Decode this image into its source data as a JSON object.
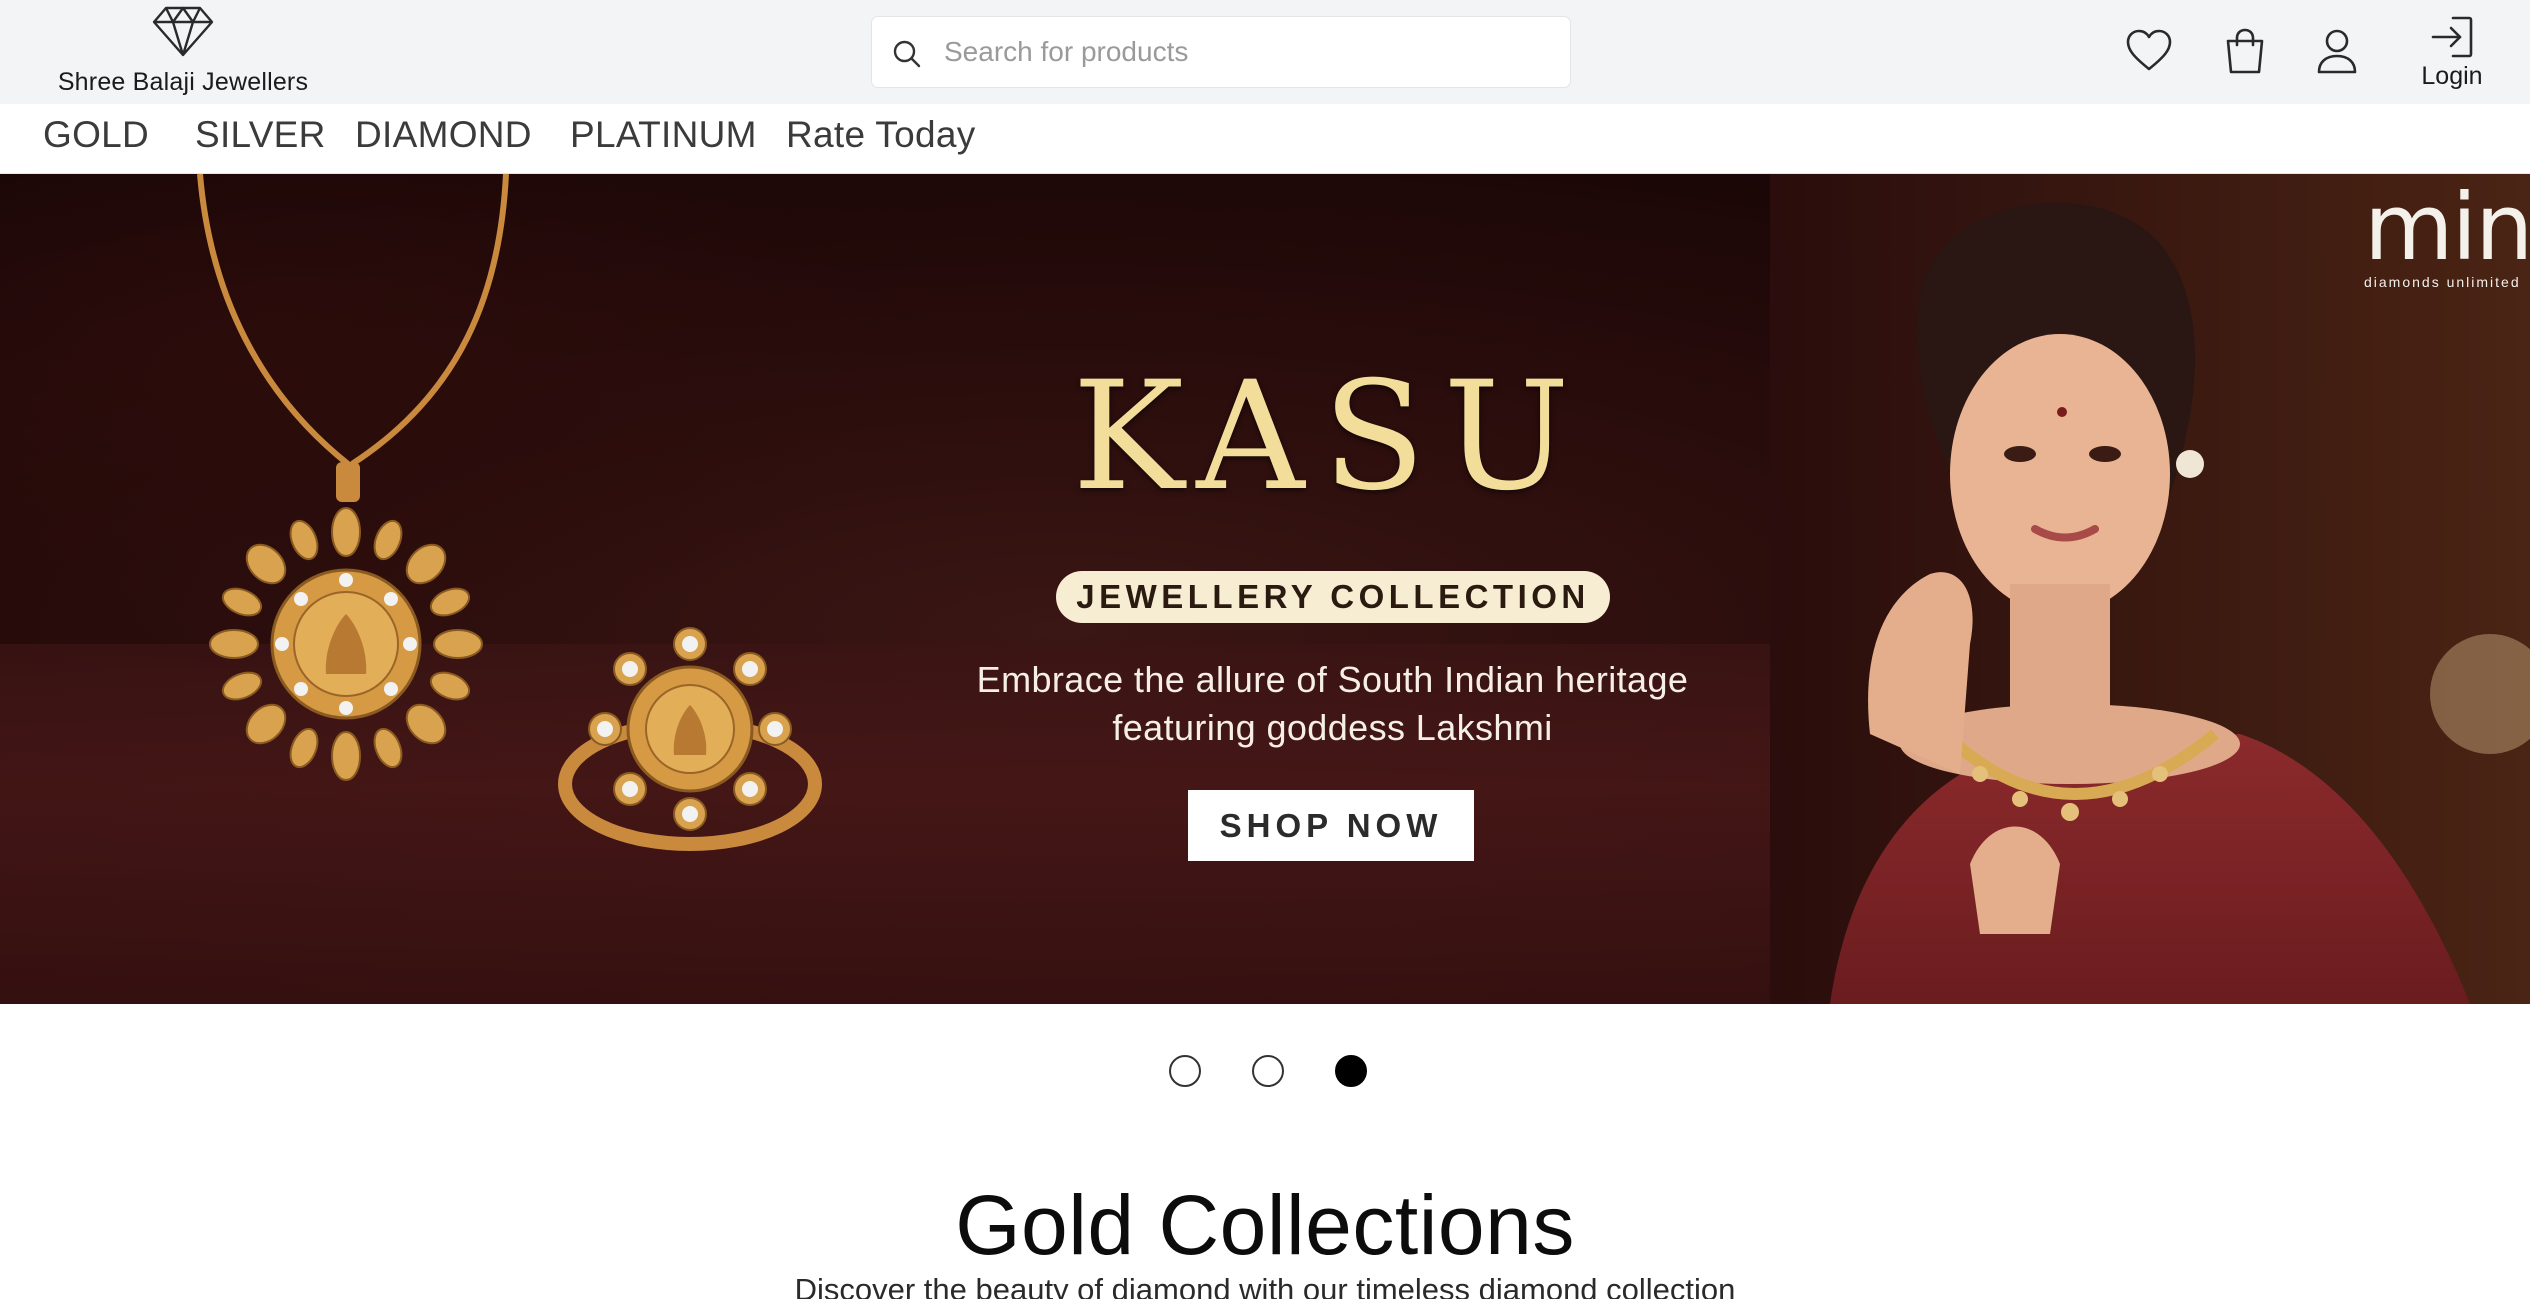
{
  "brand": {
    "name": "Shree Balaji Jewellers",
    "logo_icon": "diamond-icon"
  },
  "search": {
    "placeholder": "Search for products",
    "value": ""
  },
  "header_actions": {
    "wishlist_icon": "heart-icon",
    "cart_icon": "shopping-bag-icon",
    "account_icon": "user-icon",
    "login_icon": "login-arrow-icon",
    "login_label": "Login"
  },
  "nav": {
    "items": [
      {
        "label": "GOLD"
      },
      {
        "label": "SILVER"
      },
      {
        "label": "DIAMOND"
      },
      {
        "label": "PLATINUM"
      },
      {
        "label": "Rate Today"
      }
    ]
  },
  "hero": {
    "title": "KASU",
    "pill": "JEWELLERY COLLECTION",
    "tagline_line1": "Embrace the allure of South Indian heritage",
    "tagline_line2": "featuring goddess Lakshmi",
    "cta": "SHOP NOW",
    "partner_logo": "mine",
    "partner_sub": "diamonds unlimited",
    "accent_gold": "#f2dd9a",
    "background": "#2a0d0c"
  },
  "carousel": {
    "total": 3,
    "active_index": 2
  },
  "section": {
    "title": "Gold Collections",
    "subtitle": "Discover the beauty of diamond with our timeless diamond collection"
  }
}
